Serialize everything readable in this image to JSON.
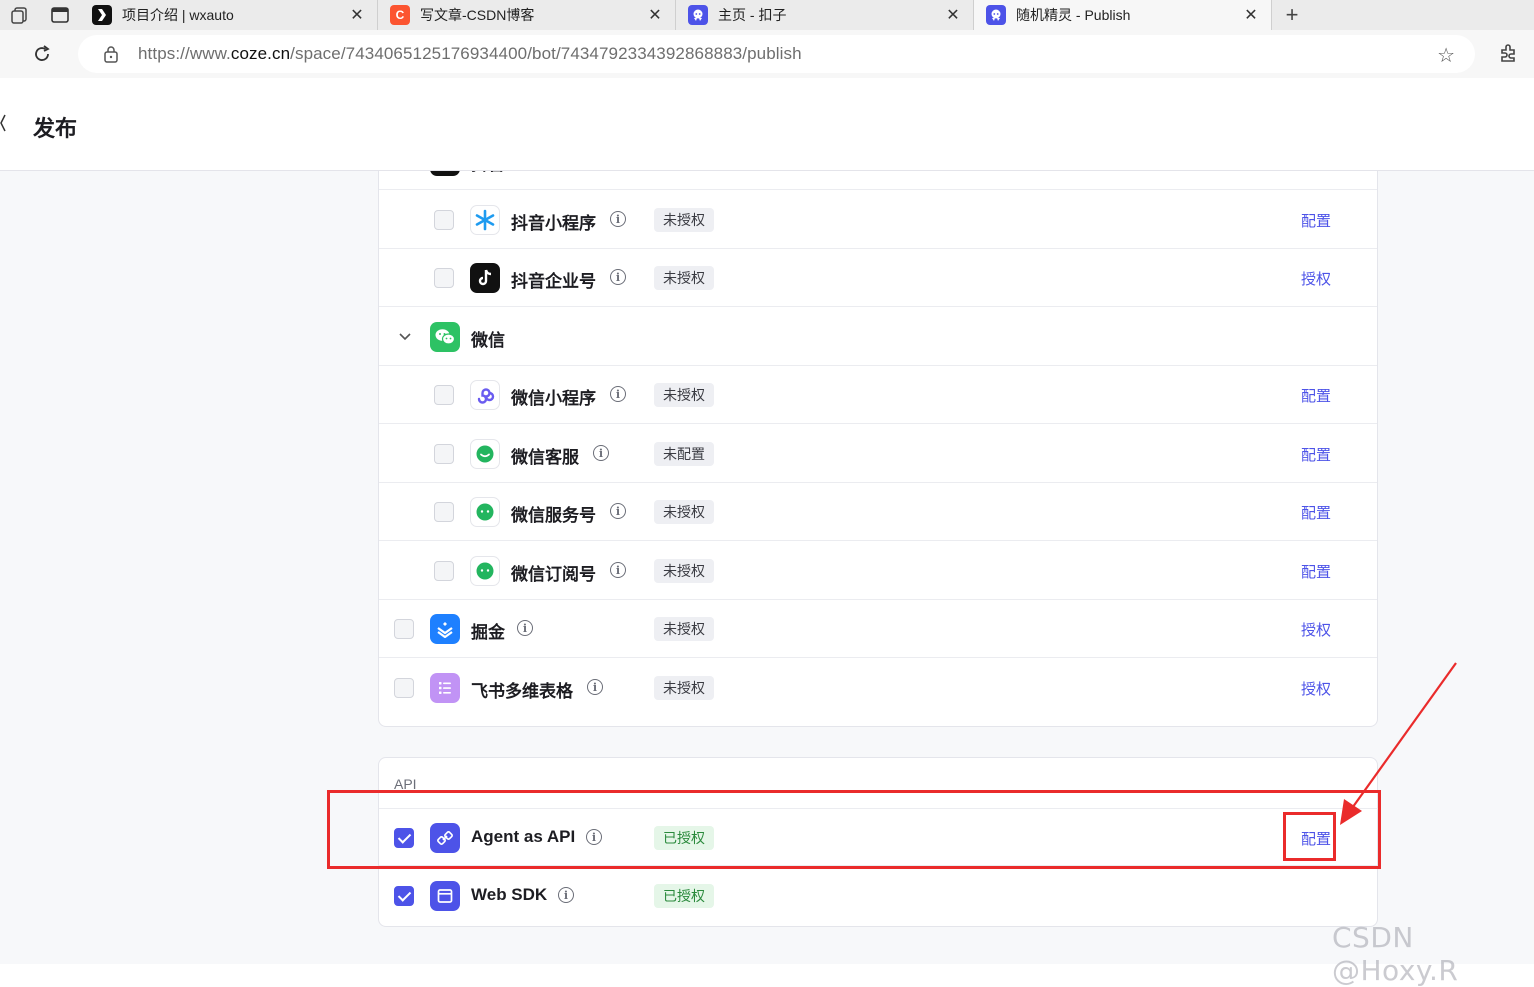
{
  "browser": {
    "tabs": [
      {
        "title": "项目介绍 | wxauto",
        "favicon": "wxauto-icon",
        "color": "#111111",
        "active": false
      },
      {
        "title": "写文章-CSDN博客",
        "favicon": "csdn-icon",
        "color": "#fc5531",
        "active": false
      },
      {
        "title": "主页 - 扣子",
        "favicon": "coze-icon",
        "color": "#4d53e8",
        "active": false
      },
      {
        "title": "随机精灵 - Publish",
        "favicon": "coze-icon",
        "color": "#4d53e8",
        "active": true
      }
    ],
    "url_prefix": "https://www.",
    "url_domain": "coze.cn",
    "url_path": "/space/7434065125176934400/bot/7434792334392868883/publish"
  },
  "header": {
    "title": "发布"
  },
  "platforms": {
    "douyin_group": {
      "label": "抖音"
    },
    "douyin_items": [
      {
        "name": "抖音小程序",
        "icon": "douyin-miniapp-icon",
        "status": "未授权",
        "action": "配置"
      },
      {
        "name": "抖音企业号",
        "icon": "douyin-icon",
        "status": "未授权",
        "action": "授权"
      }
    ],
    "wechat_group": {
      "label": "微信"
    },
    "wechat_items": [
      {
        "name": "微信小程序",
        "icon": "wechat-miniapp-icon",
        "status": "未授权",
        "action": "配置"
      },
      {
        "name": "微信客服",
        "icon": "wechat-service-icon",
        "status": "未配置",
        "action": "配置"
      },
      {
        "name": "微信服务号",
        "icon": "wechat-official-icon",
        "status": "未授权",
        "action": "配置"
      },
      {
        "name": "微信订阅号",
        "icon": "wechat-subscription-icon",
        "status": "未授权",
        "action": "配置"
      }
    ],
    "other_items": [
      {
        "name": "掘金",
        "icon": "juejin-icon",
        "status": "未授权",
        "action": "授权"
      },
      {
        "name": "飞书多维表格",
        "icon": "feishu-bitable-icon",
        "status": "未授权",
        "action": "授权"
      }
    ]
  },
  "api": {
    "section_label": "API",
    "items": [
      {
        "name": "Agent as API",
        "icon": "api-link-icon",
        "status": "已授权",
        "action": "配置",
        "checked": true
      },
      {
        "name": "Web SDK",
        "icon": "web-sdk-icon",
        "status": "已授权",
        "checked": true
      }
    ]
  },
  "watermark": "CSDN @Hoxy.R"
}
